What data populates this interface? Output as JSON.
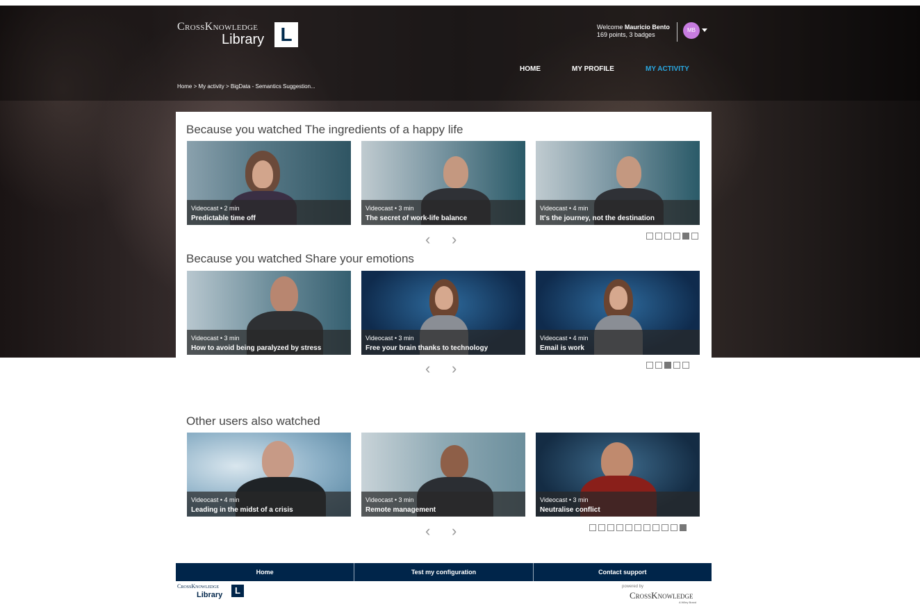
{
  "header": {
    "brand": "CrossKnowledge",
    "library": "Library",
    "logo_letter": "L",
    "welcome_prefix": "Welcome",
    "user_name": "Mauricio Bento",
    "points_badges": "169 points, 3 badges",
    "avatar_initials": "MB",
    "nav": [
      "HOME",
      "MY PROFILE",
      "MY ACTIVITY"
    ],
    "breadcrumb": "Home > My activity > BigData - Semantics Suggestion..."
  },
  "sections": [
    {
      "title": "Because you watched The ingredients of a happy life",
      "cards": [
        {
          "meta": "Videocast • 2 min",
          "title": "Predictable time off"
        },
        {
          "meta": "Videocast • 3 min",
          "title": "The secret of work-life balance"
        },
        {
          "meta": "Videocast • 4 min",
          "title": "It's the journey, not the destination"
        }
      ],
      "pages": 6,
      "active_page": 5
    },
    {
      "title": "Because you watched Share your emotions",
      "cards": [
        {
          "meta": "Videocast • 3 min",
          "title": "How to avoid being paralyzed by stress"
        },
        {
          "meta": "Videocast • 3 min",
          "title": "Free your brain thanks to technology"
        },
        {
          "meta": "Videocast • 4 min",
          "title": "Email is work"
        }
      ],
      "pages": 5,
      "active_page": 3
    },
    {
      "title": "Other users also watched",
      "cards": [
        {
          "meta": "Videocast • 4 min",
          "title": "Leading in the midst of a crisis"
        },
        {
          "meta": "Videocast • 3 min",
          "title": "Remote management"
        },
        {
          "meta": "Videocast • 3 min",
          "title": "Neutralise conflict"
        }
      ],
      "pages": 11,
      "active_page": 11
    }
  ],
  "carousel": {
    "prev": "‹",
    "next": "›"
  },
  "footer": {
    "links": [
      "Home",
      "Test my configuration",
      "Contact support"
    ],
    "brand": "CrossKnowledge",
    "library": "Library",
    "logo_letter": "L",
    "powered_by": "powered by",
    "powered_brand": "CrossKnowledge",
    "wiley": "A Wiley Brand"
  },
  "colors": {
    "accent": "#2aa7e0",
    "navy": "#00254a",
    "avatar": "#c77ce0"
  }
}
